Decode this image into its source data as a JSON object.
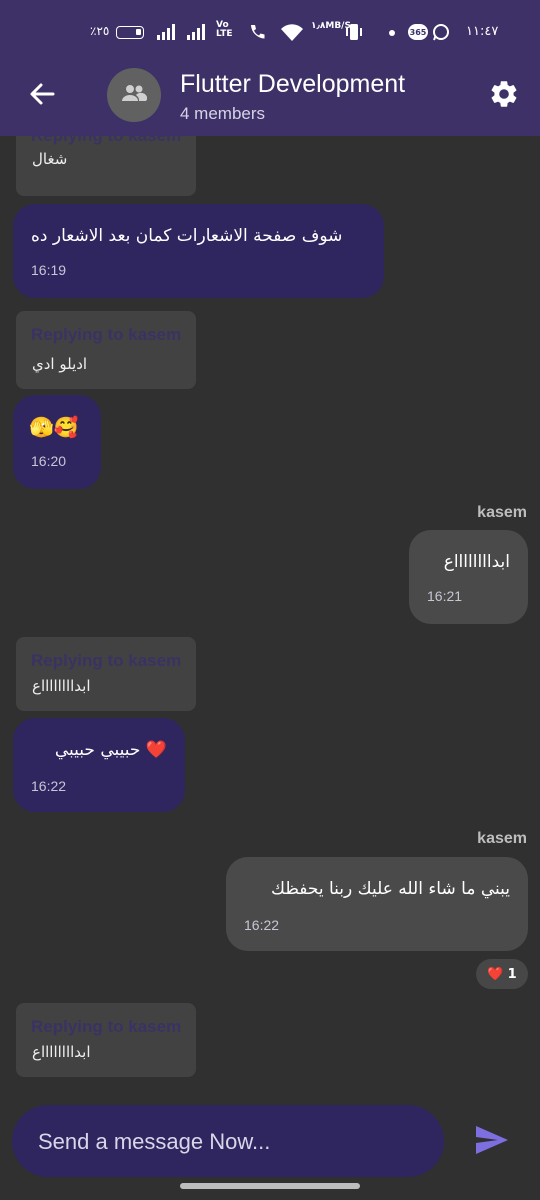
{
  "status_bar": {
    "battery": "٪٢٥",
    "volte": "Vo LTE",
    "net_speed_value": "١٫٨",
    "net_speed_unit": "MB/S",
    "time": "١١:٤٧"
  },
  "header": {
    "title": "Flutter Development",
    "subtitle": "4 members",
    "back_icon": "arrow-back-icon",
    "group_icon": "group-icon",
    "settings_icon": "gear-icon"
  },
  "messages": [
    {
      "reply_label": "Replying to kasem",
      "reply_text": "شغال"
    },
    {
      "text": "شوف صفحة الاشعارات كمان بعد الاشعار ده",
      "time": "16:19"
    },
    {
      "reply_label": "Replying to kasem",
      "reply_text": "اديلو ادي"
    },
    {
      "text": "🫣🥰",
      "time": "16:20"
    },
    {
      "sender": "kasem",
      "text": "ابدااااااااع",
      "time": "16:21"
    },
    {
      "reply_label": "Replying to kasem",
      "reply_text": "ابدااااااااع"
    },
    {
      "text": "❤️ حبيبي حبيبي",
      "time": "16:22"
    },
    {
      "sender": "kasem",
      "text": "يبني ما شاء الله عليك ربنا يحفظك",
      "time": "16:22",
      "reaction_emoji": "❤️",
      "reaction_count": "1"
    },
    {
      "reply_label": "Replying to kasem",
      "reply_text": "ابدااااااااع"
    }
  ],
  "composer": {
    "placeholder": "Send a message Now...",
    "send_icon": "send-icon"
  },
  "colors": {
    "app_bar": "#3d3168",
    "incoming_bubble": "#2f2660",
    "outgoing_bubble": "#4a4a4a",
    "background": "#303030",
    "send_accent": "#7e6fe0"
  }
}
